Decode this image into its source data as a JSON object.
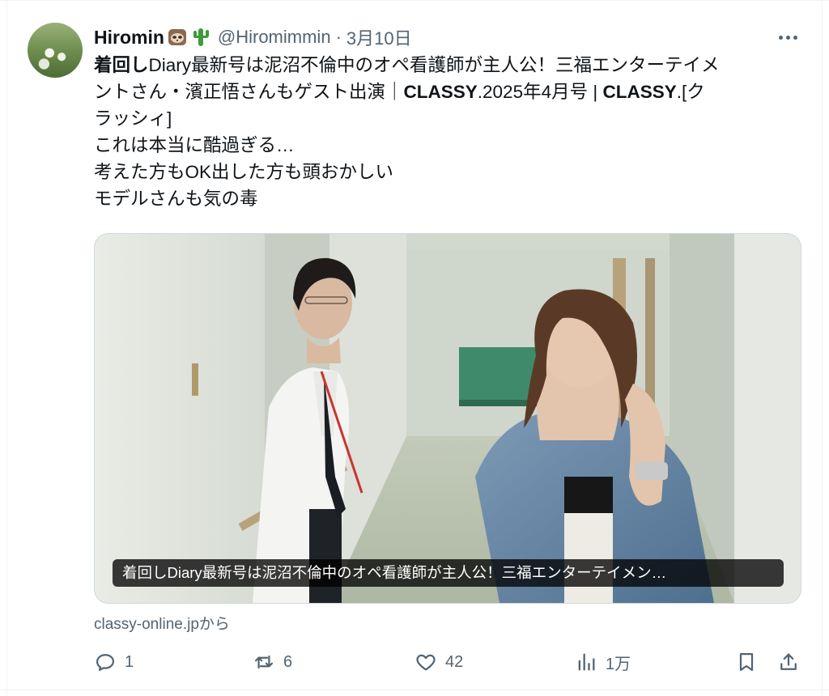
{
  "tweet": {
    "author_name": "Hiromin",
    "name_emojis": [
      "sloth-emoji",
      "cactus-emoji"
    ],
    "handle": "@Hiromimmin",
    "separator": "·",
    "date": "3月10日",
    "body": {
      "line1_bold": "着回し",
      "line1_rest": "Diary最新号は泥沼不倫中のオペ看護師が主人公！三福エンターテイメ",
      "line2_a": "ントさん・濱正悟さんもゲスト出演｜",
      "line2_b": "CLASSY",
      "line2_c": ".2025年4月号 | ",
      "line2_d": "CLASSY",
      "line2_e": ".[ク",
      "line3": "ラッシィ]",
      "line4": "これは本当に酷過ぎる…",
      "line5": "考えた方もOK出した方も頭おかしい",
      "line6": "モデルさんも気の毒"
    },
    "card": {
      "caption": "着回しDiary最新号は泥沼不倫中のオペ看護師が主人公！三福エンターテイメン…",
      "source": "classy-online.jpから"
    },
    "actions": {
      "reply_count": "1",
      "repost_count": "6",
      "like_count": "42",
      "views_count": "1万"
    }
  },
  "colors": {
    "text": "#0f1419",
    "secondary": "#536471",
    "border": "#cfd9de"
  }
}
